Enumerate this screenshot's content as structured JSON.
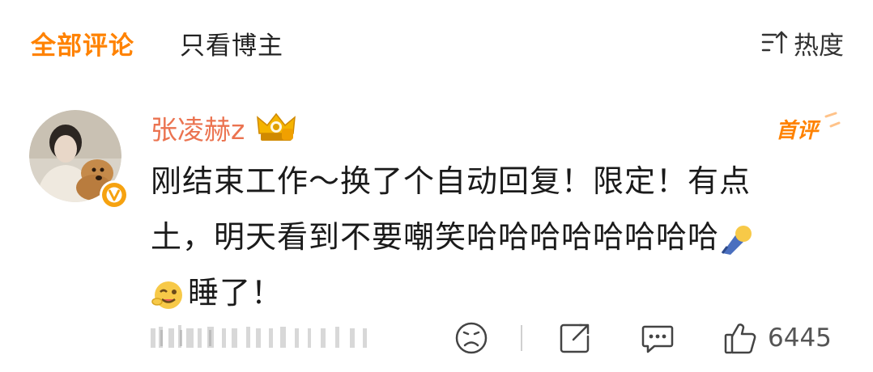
{
  "tabs": {
    "all_comments": "全部评论",
    "only_owner": "只看博主"
  },
  "sort": {
    "label": "热度",
    "icon": "sort-icon"
  },
  "comment": {
    "username": "张凌赫z",
    "badge": "首评",
    "content_line1": "刚结束工作～换了个自动回复！限定！有点",
    "content_line2": "土，明天看到不要嘲笑哈哈哈哈哈哈哈哈",
    "content_line3": "睡了！",
    "likes": "6445"
  },
  "colors": {
    "accent": "#ff8200",
    "username": "#eb7350",
    "verified": "#f6a210"
  },
  "icons": [
    "sort-icon",
    "crown-badge-icon",
    "verified-icon",
    "sleepy-emoji-icon",
    "wink-emoji-icon",
    "sad-face-icon",
    "share-icon",
    "comment-icon",
    "thumbs-up-icon"
  ]
}
